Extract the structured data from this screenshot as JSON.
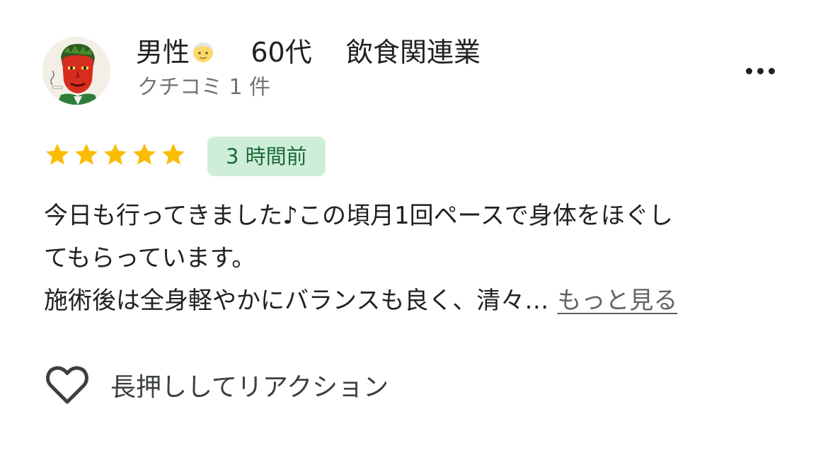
{
  "review_card": {
    "user": {
      "name": "男性",
      "age": "60代",
      "occupation": "飲食関連業",
      "review_count": "クチコミ 1 件",
      "avatar_icon": "avatar-red-face-portrait",
      "name_emoji_icon": "older-man-emoji-icon"
    },
    "menu_icon": "more-horiz-icon",
    "rating": {
      "stars": 5,
      "max": 5,
      "star_color": "#fbbc04"
    },
    "time_ago": "3 時間前",
    "review_lines": [
      "今日も行ってきました♪この頃月1回ペースで身体をほぐし",
      "てもらっています。",
      "施術後は全身軽やかにバランスも良く、清々…"
    ],
    "more_link": "もっと見る",
    "reaction": {
      "icon": "heart-outline-icon",
      "label": "長押ししてリアクション"
    },
    "colors": {
      "badge_bg": "#cfeed9",
      "badge_text": "#1e6b3a",
      "secondary_text": "#70757a"
    }
  }
}
